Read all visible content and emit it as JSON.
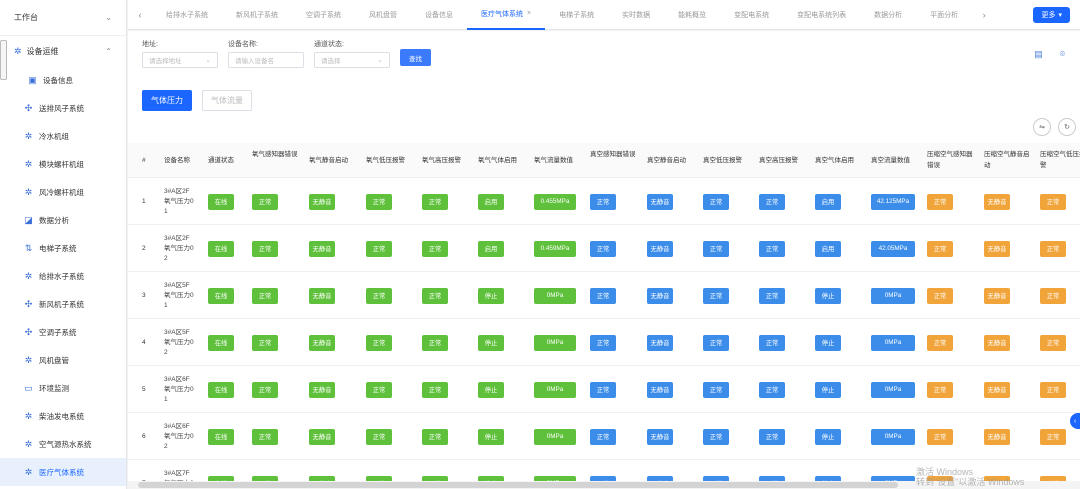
{
  "sidebar": {
    "workbench": "工作台",
    "group": "设备运维",
    "items": [
      {
        "label": "设备信息",
        "icon": "device-icon"
      },
      {
        "label": "送排风子系统",
        "icon": "fan-icon"
      },
      {
        "label": "冷水机组",
        "icon": "gear-icon"
      },
      {
        "label": "模块螺杆机组",
        "icon": "gear-icon"
      },
      {
        "label": "风冷螺杆机组",
        "icon": "gear-icon"
      },
      {
        "label": "数据分析",
        "icon": "chart-icon"
      },
      {
        "label": "电梯子系统",
        "icon": "elevator-icon"
      },
      {
        "label": "给排水子系统",
        "icon": "gear-icon"
      },
      {
        "label": "新风机子系统",
        "icon": "fan-icon"
      },
      {
        "label": "空调子系统",
        "icon": "fan-icon"
      },
      {
        "label": "风机盘管",
        "icon": "gear-icon"
      },
      {
        "label": "环境监测",
        "icon": "monitor-icon"
      },
      {
        "label": "柴油发电系统",
        "icon": "gear-icon"
      },
      {
        "label": "空气源热水系统",
        "icon": "gear-icon"
      },
      {
        "label": "医疗气体系统",
        "icon": "gear-icon"
      }
    ]
  },
  "tabs": {
    "items": [
      "给排水子系统",
      "新风机子系统",
      "空调子系统",
      "风机盘管",
      "设备信息",
      "医疗气体系统",
      "电梯子系统",
      "实时数据",
      "能耗概览",
      "变配电系统",
      "变配电系统列表",
      "数据分析",
      "平面分析"
    ],
    "close": "×",
    "more": "更多"
  },
  "filters": {
    "address_label": "地址:",
    "address_placeholder": "请选择地址",
    "name_label": "设备名称:",
    "name_placeholder": "请输入设备名",
    "status_label": "通道状态:",
    "status_placeholder": "请选择",
    "search": "查找"
  },
  "segments": {
    "pressure": "气体压力",
    "flow": "气体流量"
  },
  "columns": [
    "#",
    "设备名称",
    "通道状态",
    "氧气感知器错误",
    "氧气静音启动",
    "氧气低压报警",
    "氧气高压报警",
    "氧气气体启用",
    "氧气流量数值",
    "真空感知器错误",
    "真空静音启动",
    "真空低压报警",
    "真空高压报警",
    "真空气体启用",
    "真空流量数值",
    "压缩空气感知器错误",
    "压缩空气静音启动",
    "压缩空气低压报警"
  ],
  "rows": [
    {
      "idx": "1",
      "name": [
        "3#A区2F",
        "氧气压力0",
        "1"
      ],
      "ch": "在线",
      "o2err": "正常",
      "o2mute": "无静音",
      "o2low": "正常",
      "o2high": "正常",
      "o2en": "启用",
      "o2flow": "0.455MPa",
      "vaerr": "正常",
      "vamute": "无静音",
      "valow": "正常",
      "vahigh": "正常",
      "vaen": "启用",
      "vaflow": "42.125MPa",
      "caerr": "正常",
      "camute": "无静音",
      "calow": "正常"
    },
    {
      "idx": "2",
      "name": [
        "3#A区2F",
        "氧气压力0",
        "2"
      ],
      "ch": "在线",
      "o2err": "正常",
      "o2mute": "无静音",
      "o2low": "正常",
      "o2high": "正常",
      "o2en": "启用",
      "o2flow": "0.459MPa",
      "vaerr": "正常",
      "vamute": "无静音",
      "valow": "正常",
      "vahigh": "正常",
      "vaen": "启用",
      "vaflow": "42.05MPa",
      "caerr": "正常",
      "camute": "无静音",
      "calow": "正常"
    },
    {
      "idx": "3",
      "name": [
        "3#A区5F",
        "氧气压力0",
        "1"
      ],
      "ch": "在线",
      "o2err": "正常",
      "o2mute": "无静音",
      "o2low": "正常",
      "o2high": "正常",
      "o2en": "停止",
      "o2flow": "0MPa",
      "vaerr": "正常",
      "vamute": "无静音",
      "valow": "正常",
      "vahigh": "正常",
      "vaen": "停止",
      "vaflow": "0MPa",
      "caerr": "正常",
      "camute": "无静音",
      "calow": "正常"
    },
    {
      "idx": "4",
      "name": [
        "3#A区5F",
        "氧气压力0",
        "2"
      ],
      "ch": "在线",
      "o2err": "正常",
      "o2mute": "无静音",
      "o2low": "正常",
      "o2high": "正常",
      "o2en": "停止",
      "o2flow": "0MPa",
      "vaerr": "正常",
      "vamute": "无静音",
      "valow": "正常",
      "vahigh": "正常",
      "vaen": "停止",
      "vaflow": "0MPa",
      "caerr": "正常",
      "camute": "无静音",
      "calow": "正常"
    },
    {
      "idx": "5",
      "name": [
        "3#A区6F",
        "氧气压力0",
        "1"
      ],
      "ch": "在线",
      "o2err": "正常",
      "o2mute": "无静音",
      "o2low": "正常",
      "o2high": "正常",
      "o2en": "停止",
      "o2flow": "0MPa",
      "vaerr": "正常",
      "vamute": "无静音",
      "valow": "正常",
      "vahigh": "正常",
      "vaen": "停止",
      "vaflow": "0MPa",
      "caerr": "正常",
      "camute": "无静音",
      "calow": "正常"
    },
    {
      "idx": "6",
      "name": [
        "3#A区6F",
        "氧气压力0",
        "2"
      ],
      "ch": "在线",
      "o2err": "正常",
      "o2mute": "无静音",
      "o2low": "正常",
      "o2high": "正常",
      "o2en": "停止",
      "o2flow": "0MPa",
      "vaerr": "正常",
      "vamute": "无静音",
      "valow": "正常",
      "vahigh": "正常",
      "vaen": "停止",
      "vaflow": "0MPa",
      "caerr": "正常",
      "camute": "无静音",
      "calow": "正常"
    },
    {
      "idx": "7",
      "name": [
        "3#A区7F",
        "氧气压力0",
        "1"
      ],
      "ch": "在线",
      "o2err": "正常",
      "o2mute": "无静音",
      "o2low": "正常",
      "o2high": "正常",
      "o2en": "停止",
      "o2flow": "0MPa",
      "vaerr": "正常",
      "vamute": "无静音",
      "valow": "正常",
      "vahigh": "正常",
      "vaen": "停止",
      "vaflow": "0MPa",
      "caerr": "正常",
      "camute": "无静音",
      "calow": "正常"
    }
  ],
  "watermark": [
    "激活 Windows",
    "转到\"设置\"以激活 Windows"
  ],
  "colors": {
    "accent": "#1a66ff",
    "online": "#5ec03b",
    "vacuum": "#3c8dea",
    "air": "#f0a43a"
  }
}
